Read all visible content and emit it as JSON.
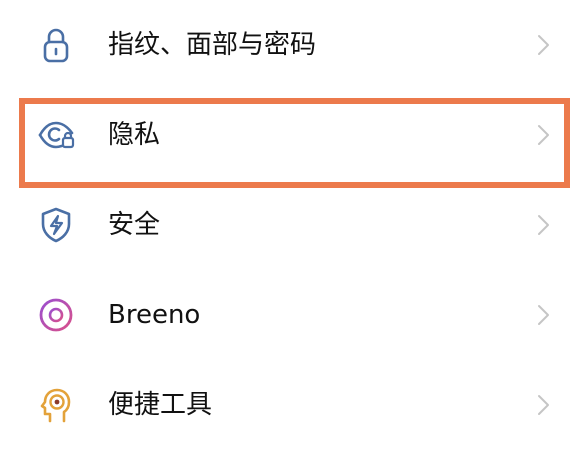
{
  "settings_list": {
    "items": [
      {
        "label": "指纹、面部与密码",
        "icon": "lock-icon"
      },
      {
        "label": "隐私",
        "icon": "privacy-eye-lock-icon"
      },
      {
        "label": "安全",
        "icon": "shield-bolt-icon"
      },
      {
        "label": "Breeno",
        "icon": "breeno-ring-icon"
      },
      {
        "label": "便捷工具",
        "icon": "head-target-icon"
      }
    ],
    "chevron_icon": "chevron-right-icon"
  },
  "highlight": {
    "target_label": "隐私",
    "color": "#ec7a4c"
  },
  "colors": {
    "icon_blue": "#4a6fa5",
    "icon_purple": "#b54fb0",
    "icon_orange": "#e3a23a",
    "chevron": "#c5c5c5"
  }
}
